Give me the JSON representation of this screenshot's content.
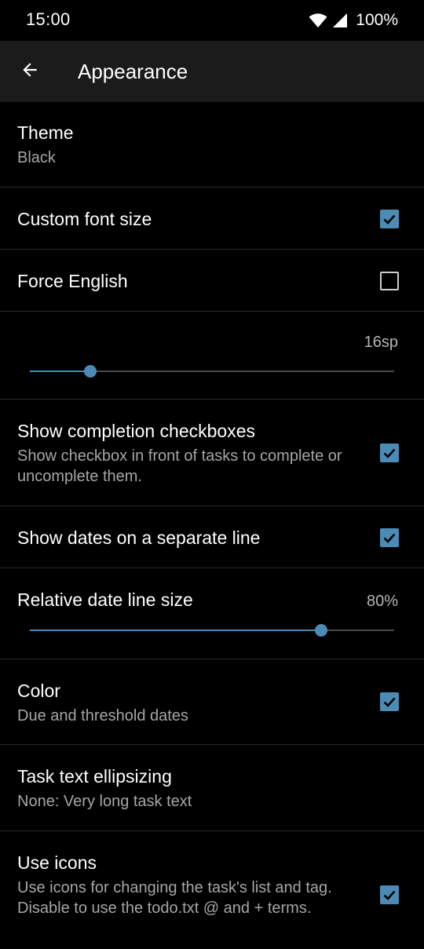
{
  "status_bar": {
    "time": "15:00",
    "battery": "100%",
    "icons": [
      "wifi-icon",
      "signal-icon"
    ]
  },
  "app_bar": {
    "back_icon": "arrow-left-icon",
    "title": "Appearance"
  },
  "colors": {
    "accent": "#4b8bb6",
    "background": "#000000",
    "app_bar": "#1b1b1b",
    "divider": "#2a2a2a",
    "secondary_text": "#a6a6a6"
  },
  "settings": {
    "theme": {
      "title": "Theme",
      "summary": "Black"
    },
    "custom_font_size": {
      "title": "Custom font size",
      "checked": true
    },
    "force_english": {
      "title": "Force English",
      "checked": false
    },
    "font_size_slider": {
      "value_label": "16sp",
      "fraction": 0.165
    },
    "show_completion_checkboxes": {
      "title": "Show completion checkboxes",
      "summary": "Show checkbox in front of tasks to complete or uncomplete them.",
      "checked": true
    },
    "show_dates_separate_line": {
      "title": "Show dates on a separate line",
      "checked": true
    },
    "relative_date_line_size": {
      "title": "Relative date line size",
      "value_label": "80%",
      "fraction": 0.8
    },
    "color": {
      "title": "Color",
      "summary": "Due and threshold dates",
      "checked": true
    },
    "task_text_ellipsizing": {
      "title": "Task text ellipsizing",
      "summary": "None: Very long task text"
    },
    "use_icons": {
      "title": "Use icons",
      "summary": "Use icons for changing the task's list and tag. Disable to use the todo.txt @ and + terms.",
      "checked": true
    }
  }
}
